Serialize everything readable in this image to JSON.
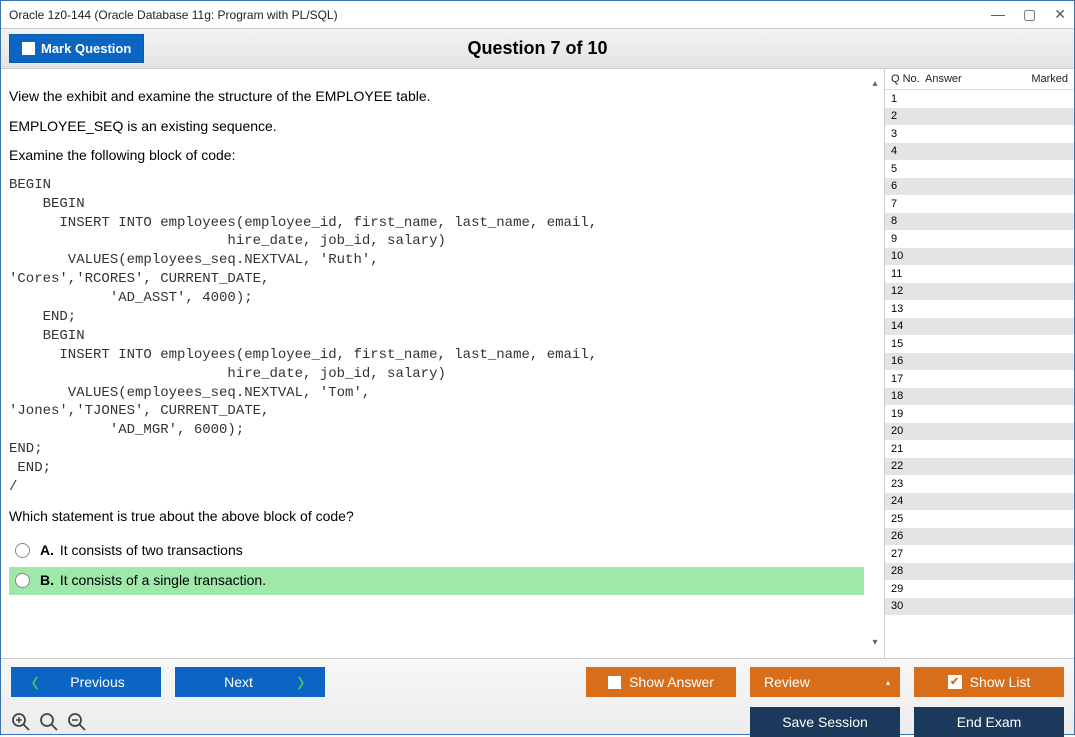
{
  "window": {
    "title": "Oracle 1z0-144 (Oracle Database 11g: Program with PL/SQL)"
  },
  "header": {
    "mark_label": "Mark Question",
    "question_counter": "Question 7 of 10"
  },
  "question": {
    "intro": [
      "View the exhibit and examine the structure of the EMPLOYEE table.",
      "EMPLOYEE_SEQ is an existing sequence.",
      "Examine the following block of code:"
    ],
    "code": "BEGIN\n    BEGIN\n      INSERT INTO employees(employee_id, first_name, last_name, email,\n                          hire_date, job_id, salary)\n       VALUES(employees_seq.NEXTVAL, 'Ruth',\n'Cores','RCORES', CURRENT_DATE,\n            'AD_ASST', 4000);\n    END;\n    BEGIN\n      INSERT INTO employees(employee_id, first_name, last_name, email,\n                          hire_date, job_id, salary)\n       VALUES(employees_seq.NEXTVAL, 'Tom',\n'Jones','TJONES', CURRENT_DATE,\n            'AD_MGR', 6000);\nEND;\n END;\n/",
    "prompt": "Which statement is true about the above block of code?",
    "options": [
      {
        "key": "A.",
        "text": "It consists of two transactions",
        "selected": false
      },
      {
        "key": "B.",
        "text": "It consists of a single transaction.",
        "selected": true
      }
    ]
  },
  "sidebar": {
    "headers": [
      "Q No.",
      "Answer",
      "Marked"
    ],
    "rows": [
      1,
      2,
      3,
      4,
      5,
      6,
      7,
      8,
      9,
      10,
      11,
      12,
      13,
      14,
      15,
      16,
      17,
      18,
      19,
      20,
      21,
      22,
      23,
      24,
      25,
      26,
      27,
      28,
      29,
      30
    ]
  },
  "footer": {
    "previous": "Previous",
    "next": "Next",
    "show_answer": "Show Answer",
    "review": "Review",
    "show_list": "Show List",
    "save_session": "Save Session",
    "end_exam": "End Exam"
  }
}
